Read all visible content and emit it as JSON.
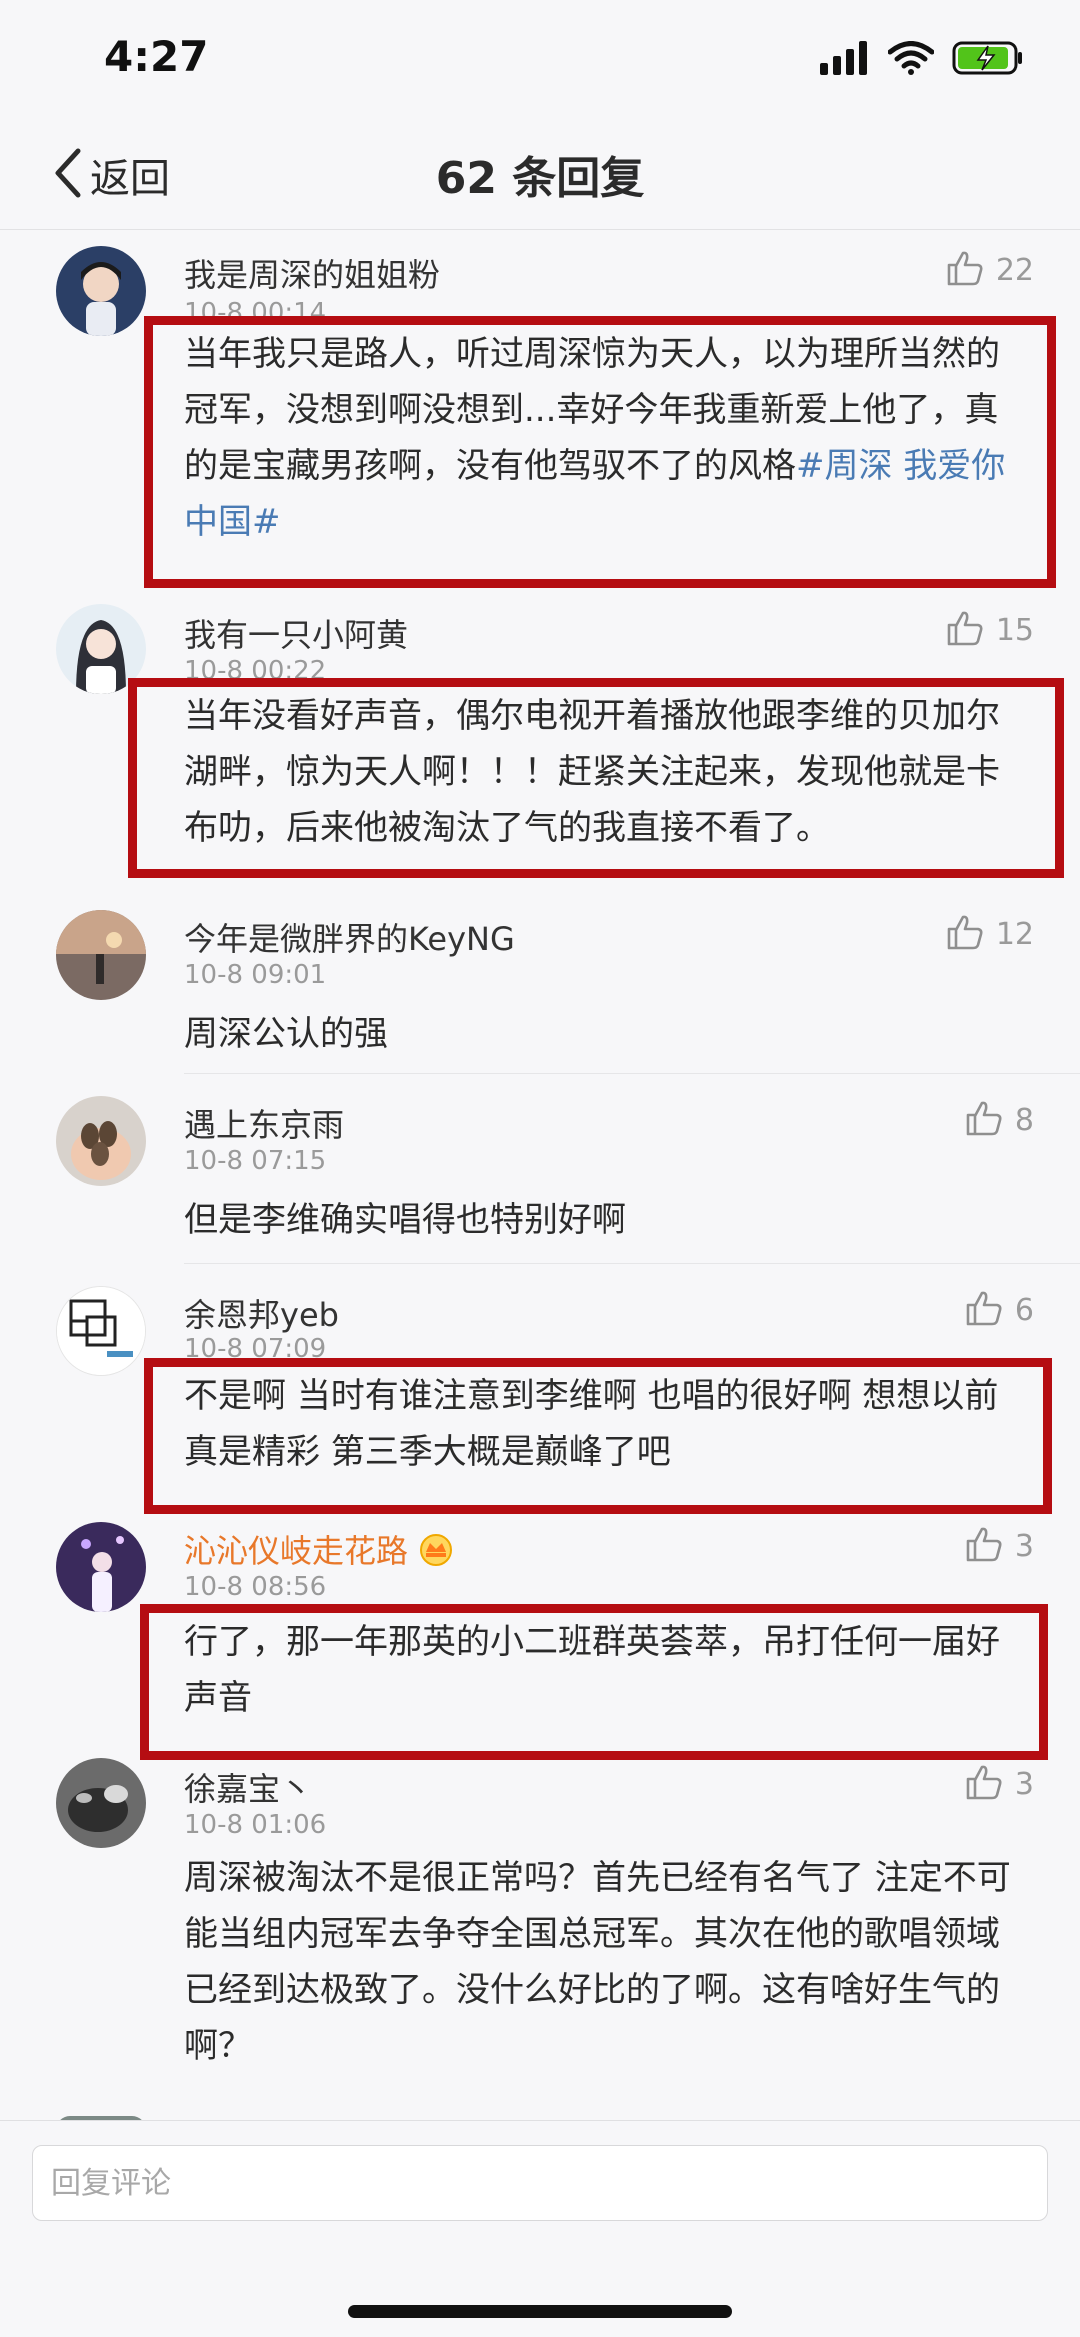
{
  "status_bar": {
    "time": "4:27"
  },
  "nav": {
    "back_label": "返回",
    "title": "62 条回复"
  },
  "comments": [
    {
      "username": "我是周深的姐姐粉",
      "time": "10-8 00:14",
      "likes": "22",
      "text": "当年我只是路人，听过周深惊为天人，以为理所当然的冠军，没想到啊没想到...幸好今年我重新爱上他了，真的是宝藏男孩啊，没有他驾驭不了的风格",
      "tag": "#周深 我爱你中国#",
      "highlighted": true
    },
    {
      "username": "我有一只小阿黄",
      "time": "10-8 00:22",
      "likes": "15",
      "text": "当年没看好声音，偶尔电视开着播放他跟李维的贝加尔湖畔，惊为天人啊！！！赶紧关注起来，发现他就是卡布叻，后来他被淘汰了气的我直接不看了。",
      "highlighted": true
    },
    {
      "username": "今年是微胖界的KeyNG",
      "time": "10-8 09:01",
      "likes": "12",
      "text": "周深公认的强",
      "highlighted": false
    },
    {
      "username": "遇上东京雨",
      "time": "10-8 07:15",
      "likes": "8",
      "text": "但是李维确实唱得也特别好啊",
      "highlighted": false
    },
    {
      "username": "余恩邦yeb",
      "time": "10-8 07:09",
      "likes": "6",
      "text": "不是啊 当时有谁注意到李维啊 也唱的很好啊 想想以前真是精彩 第三季大概是巅峰了吧",
      "highlighted": true
    },
    {
      "username": "沁沁仪岐走花路",
      "time": "10-8 08:56",
      "likes": "3",
      "text": "行了，那一年那英的小二班群英荟萃，吊打任何一届好声音",
      "highlighted": true
    },
    {
      "username": "徐嘉宝丶",
      "time": "10-8 01:06",
      "likes": "3",
      "text": "周深被淘汰不是很正常吗？首先已经有名气了 注定不可能当组内冠军去争夺全国总冠军。其次在他的歌唱领域已经到达极致了。没什么好比的了啊。这有啥好生气的啊？",
      "highlighted": false
    }
  ],
  "reply_bar": {
    "placeholder": "回复评论"
  },
  "colors": {
    "highlight_border": "#b50d12",
    "tag": "#4a7bb4",
    "vip_username": "#e8782a",
    "meta_gray": "#9a9a9a"
  },
  "icons": [
    "back-chevron-icon",
    "thumb-up-icon",
    "signal-icon",
    "wifi-icon",
    "battery-charging-icon",
    "vip-badge-icon"
  ]
}
